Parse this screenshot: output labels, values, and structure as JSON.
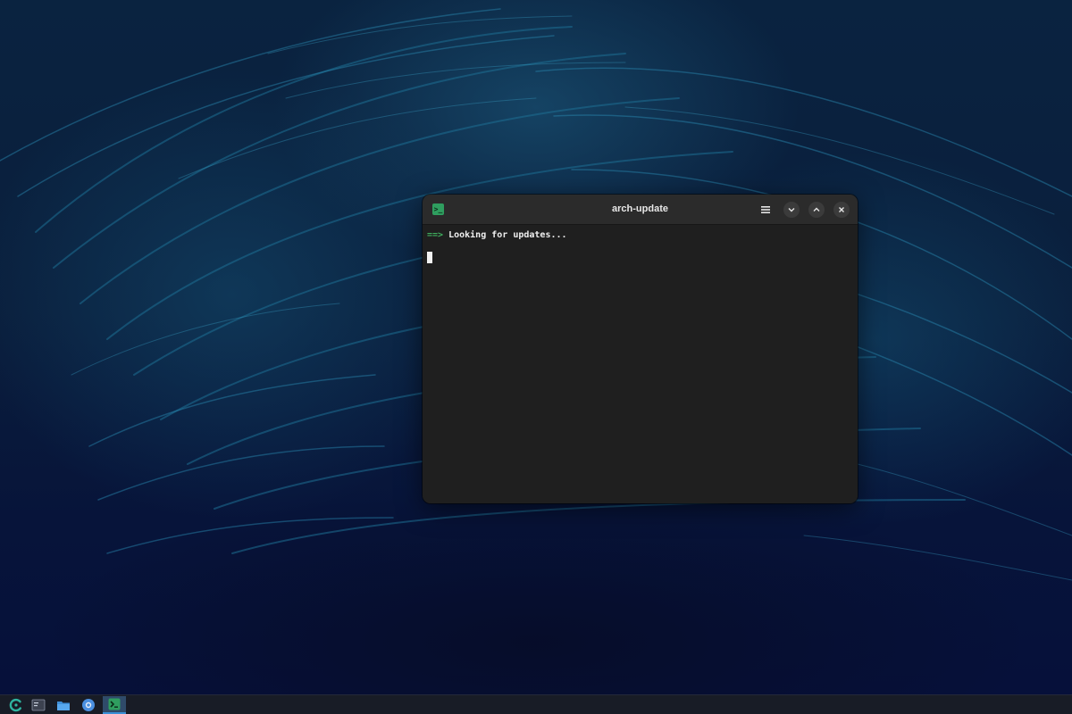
{
  "window": {
    "title": "arch-update",
    "app_icon": "terminal-icon",
    "controls": {
      "menu": "hamburger-menu-icon",
      "minimize": "chevron-down-icon",
      "maximize": "chevron-up-icon",
      "close": "close-icon"
    }
  },
  "terminal": {
    "prompt_arrow": "==>",
    "line_1_text": " Looking for updates..."
  },
  "taskbar": {
    "items": [
      {
        "name": "launcher",
        "icon": "app-launcher-icon"
      },
      {
        "name": "show-desktop",
        "icon": "desktop-icon"
      },
      {
        "name": "files",
        "icon": "folder-icon"
      },
      {
        "name": "browser",
        "icon": "browser-icon"
      },
      {
        "name": "terminal",
        "icon": "terminal-icon",
        "active": true
      }
    ]
  },
  "colors": {
    "accent_green": "#3fae5e",
    "terminal_bg": "#1f1f1f",
    "titlebar_bg": "#2b2b2b",
    "taskbar_active": "#3a8fd6"
  }
}
